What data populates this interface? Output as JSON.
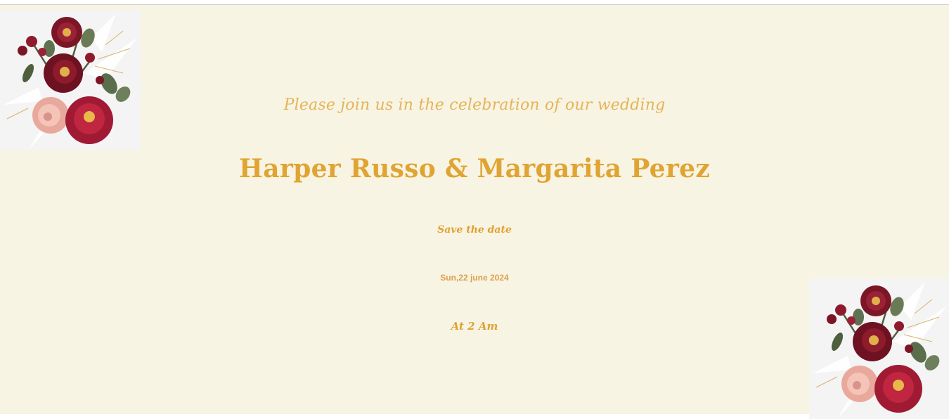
{
  "invitation": {
    "invite_line": "Please join us in the celebration of our wedding",
    "couple_names": "Harper Russo & Margarita Perez",
    "save_the_date": "Save the date",
    "date": "Sun,22 june 2024",
    "time": "At 2 Am"
  },
  "colors": {
    "background": "#f8f4e3",
    "text_gold": "#e0a432",
    "rose_dark": "#8e1b2c",
    "rose_crimson": "#b5203a",
    "rose_pink": "#f0b3a8",
    "leaf_green": "#5b6e4c"
  },
  "decorations": {
    "top_left_icon": "rose-bouquet-icon",
    "bottom_right_icon": "rose-bouquet-icon"
  }
}
